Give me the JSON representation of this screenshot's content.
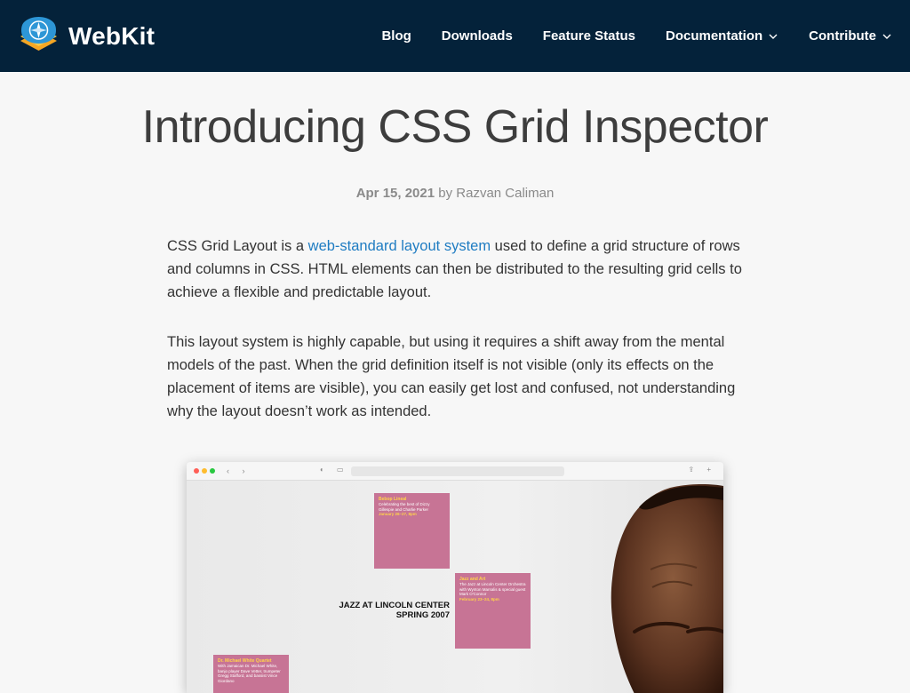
{
  "header": {
    "brand": "WebKit",
    "nav": [
      {
        "label": "Blog"
      },
      {
        "label": "Downloads"
      },
      {
        "label": "Feature Status"
      },
      {
        "label": "Documentation",
        "dropdown": true
      },
      {
        "label": "Contribute",
        "dropdown": true
      }
    ]
  },
  "article": {
    "title": "Introducing CSS Grid Inspector",
    "date": "Apr 15, 2021",
    "by": "by",
    "author": "Razvan Caliman",
    "p1_before": "CSS Grid Layout is a ",
    "p1_link": "web-standard layout system",
    "p1_after": " used to define a grid structure of rows and columns in CSS. HTML elements can then be distributed to the resulting grid cells to achieve a flexible and predictable layout.",
    "p2": "This layout system is highly capable, but using it requires a shift away from the mental models of the past. When the grid definition itself is not visible (only its effects on the placement of items are visible), you can easily get lost and confused, not understanding why the layout doesn’t work as intended."
  },
  "figure": {
    "headline_line1": "JAZZ AT LINCOLN CENTER",
    "headline_line2": "SPRING 2007",
    "cards": [
      {
        "title": "Bebop Lineal",
        "desc": "Celebrating the best of Dizzy Gillespie and Charlie Parker",
        "date": "January 26–27, 8pm"
      },
      {
        "title": "Jazz and Art",
        "desc": "The Jazz at Lincoln Center Orchestra with Wynton Marsalis & special guest Mark O'Connor",
        "date": "February 23–24, 8pm"
      },
      {
        "title": "Dr. Michael White Quartet",
        "desc": "With Jamaican Dr. Michael White, banjo player Dave Vetter, trumpeter Gregg Stafford, and bassist Vince Giordano",
        "date": ""
      }
    ]
  },
  "colors": {
    "header_bg": "#04223a",
    "link": "#1f7cc2",
    "card": "#c77495",
    "card_accent": "#ffd34a"
  }
}
